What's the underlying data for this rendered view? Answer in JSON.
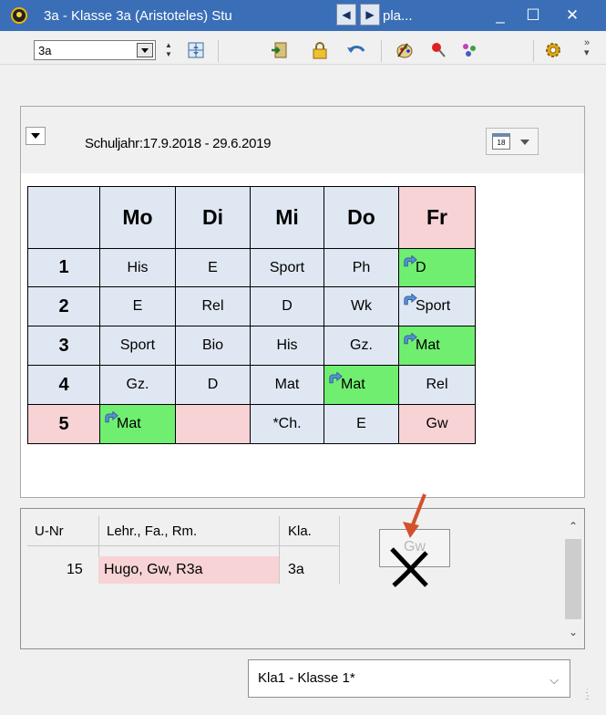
{
  "window": {
    "title": "3a - Klasse 3a (Aristoteles) Stu",
    "title_tail": "pla...",
    "accent": "#3a6fb7"
  },
  "title_nav": {
    "prev_icon": "◀",
    "next_icon": "▶"
  },
  "window_controls": {
    "minimize": "_",
    "maximize": "☐",
    "close": "✕"
  },
  "toolbar": {
    "class_select_value": "3a",
    "icons": [
      "grid-view-icon",
      "import-icon",
      "lock-icon",
      "undo-icon",
      "palette-icon",
      "pin-icon",
      "users-icon",
      "settings-icon"
    ],
    "more_label": ">>"
  },
  "header": {
    "school_year": "Schuljahr:17.9.2018 - 29.6.2019",
    "calendar_day": "18"
  },
  "timetable": {
    "days": [
      "Mo",
      "Di",
      "Mi",
      "Do",
      "Fr"
    ],
    "periods": [
      "1",
      "2",
      "3",
      "4",
      "5"
    ],
    "rows": [
      [
        {
          "t": "His",
          "c": "norm"
        },
        {
          "t": "E",
          "c": "norm"
        },
        {
          "t": "Sport",
          "c": "norm"
        },
        {
          "t": "Ph",
          "c": "norm"
        },
        {
          "t": "D",
          "c": "green",
          "m": true
        }
      ],
      [
        {
          "t": "E",
          "c": "norm"
        },
        {
          "t": "Rel",
          "c": "norm"
        },
        {
          "t": "D",
          "c": "norm"
        },
        {
          "t": "Wk",
          "c": "norm"
        },
        {
          "t": "Sport",
          "c": "norm",
          "m": true
        }
      ],
      [
        {
          "t": "Sport",
          "c": "norm"
        },
        {
          "t": "Bio",
          "c": "norm"
        },
        {
          "t": "His",
          "c": "norm"
        },
        {
          "t": "Gz.",
          "c": "norm"
        },
        {
          "t": "Mat",
          "c": "green",
          "m": true
        }
      ],
      [
        {
          "t": "Gz.",
          "c": "norm"
        },
        {
          "t": "D",
          "c": "norm"
        },
        {
          "t": "Mat",
          "c": "norm"
        },
        {
          "t": "Mat",
          "c": "green",
          "m": true
        },
        {
          "t": "Rel",
          "c": "norm"
        }
      ],
      [
        {
          "t": "Mat",
          "c": "green",
          "m": true
        },
        {
          "t": "",
          "c": "pink"
        },
        {
          "t": "*Ch.",
          "c": "norm"
        },
        {
          "t": "E",
          "c": "norm"
        },
        {
          "t": "Gw",
          "c": "pink"
        }
      ]
    ],
    "colors": {
      "normal": "#dfe7f2",
      "moved": "#70ee70",
      "highlight": "#f7d3d5"
    }
  },
  "lessons": {
    "columns": [
      "U-Nr",
      "Lehr., Fa., Rm.",
      "Kla."
    ],
    "rows": [
      {
        "nr": "15",
        "info": "Hugo, Gw, R3a",
        "klass": "3a"
      }
    ],
    "drag_label": "Gw"
  },
  "footer": {
    "view_select_value": "Kla1 - Klasse 1*"
  }
}
